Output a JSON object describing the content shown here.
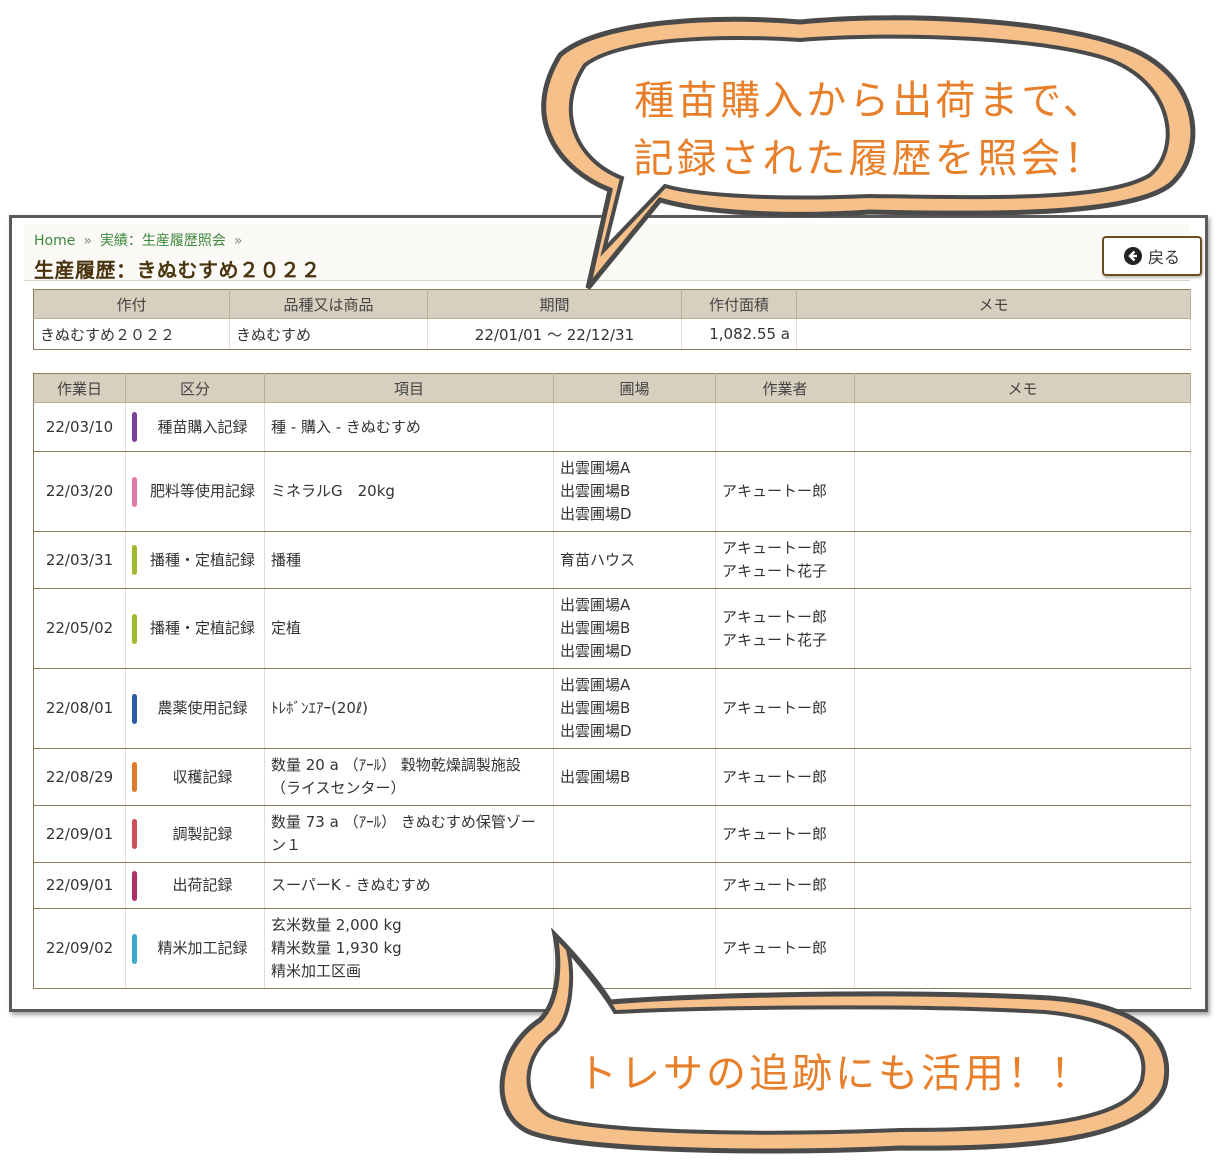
{
  "breadcrumb": {
    "home": "Home",
    "separator": "»",
    "current": "実績：生産履歴照会"
  },
  "page_title": "生産履歴：きぬむすめ２０２２",
  "back_button": {
    "label": "戻る",
    "icon": "arrow-left-circle-icon"
  },
  "summary": {
    "headers": [
      "作付",
      "品種又は商品",
      "期間",
      "作付面積",
      "メモ"
    ],
    "row": {
      "crop": "きぬむすめ２０２２",
      "variety": "きぬむすめ",
      "period": "22/01/01 ～ 22/12/31",
      "area": "1,082.55 a",
      "memo": ""
    }
  },
  "records": {
    "headers": [
      "作業日",
      "区分",
      "項目",
      "圃場",
      "作業者",
      "メモ"
    ],
    "rows": [
      {
        "date": "22/03/10",
        "category": "種苗購入記録",
        "color": "#7b3fa0",
        "item": [
          "種 - 購入 - きぬむすめ"
        ],
        "field": [],
        "worker": []
      },
      {
        "date": "22/03/20",
        "category": "肥料等使用記録",
        "color": "#e07aa8",
        "item": [
          "ミネラルG　20kg"
        ],
        "field": [
          "出雲圃場A",
          "出雲圃場B",
          "出雲圃場D"
        ],
        "worker": [
          "アキュートー郎"
        ]
      },
      {
        "date": "22/03/31",
        "category": "播種・定植記録",
        "color": "#9dbb2a",
        "item": [
          "播種"
        ],
        "field": [
          "育苗ハウス"
        ],
        "worker": [
          "アキュートー郎",
          "アキュート花子"
        ]
      },
      {
        "date": "22/05/02",
        "category": "播種・定植記録",
        "color": "#9dbb2a",
        "item": [
          "定植"
        ],
        "field": [
          "出雲圃場A",
          "出雲圃場B",
          "出雲圃場D"
        ],
        "worker": [
          "アキュートー郎",
          "アキュート花子"
        ]
      },
      {
        "date": "22/08/01",
        "category": "農薬使用記録",
        "color": "#2a5aa8",
        "item": [
          "ﾄﾚﾎﾞﾝｴｱｰ(20ℓ)"
        ],
        "field": [
          "出雲圃場A",
          "出雲圃場B",
          "出雲圃場D"
        ],
        "worker": [
          "アキュートー郎"
        ]
      },
      {
        "date": "22/08/29",
        "category": "収穫記録",
        "color": "#e07a2a",
        "item": [
          "数量 20 a （ｱｰﾙ） 穀物乾燥調製施設",
          "（ライスセンター）"
        ],
        "field": [
          "出雲圃場B"
        ],
        "worker": [
          "アキュートー郎"
        ]
      },
      {
        "date": "22/09/01",
        "category": "調製記録",
        "color": "#d0505a",
        "item": [
          "数量 73 a （ｱｰﾙ） きぬむすめ保管ゾー",
          "ン１"
        ],
        "field": [],
        "worker": [
          "アキュートー郎"
        ]
      },
      {
        "date": "22/09/01",
        "category": "出荷記録",
        "color": "#b0306a",
        "item": [
          "スーパーK - きぬむすめ"
        ],
        "field": [],
        "worker": [
          "アキュートー郎"
        ]
      },
      {
        "date": "22/09/02",
        "category": "精米加工記録",
        "color": "#3aa8d0",
        "item": [
          "玄米数量 2,000 kg",
          "精米数量 1,930 kg",
          "精米加工区画"
        ],
        "field": [],
        "worker": [
          "アキュートー郎"
        ]
      }
    ]
  },
  "callout_top": {
    "line1": "種苗購入から出荷まで、",
    "line2": "記録された履歴を照会！"
  },
  "callout_bottom": {
    "text": "トレサの追跡にも活用！！"
  },
  "colors": {
    "bubble_fill": "#f5c08a",
    "bubble_text": "#e87f2a",
    "header_bg": "#d8cfbf"
  }
}
